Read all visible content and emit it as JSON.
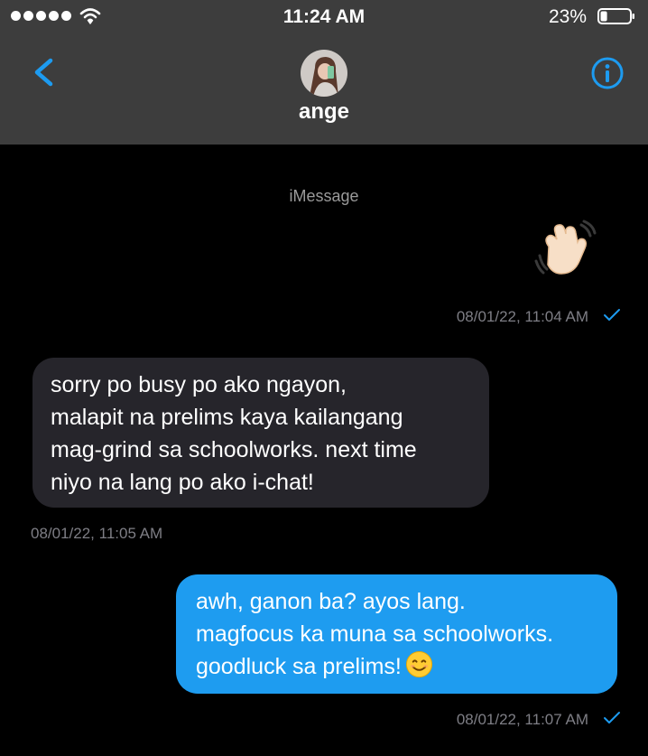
{
  "status_bar": {
    "time": "11:24 AM",
    "battery": "23%",
    "battery_level": 0.23,
    "signal_bars": 5,
    "icons": [
      "signal-dots-icon",
      "wifi-icon",
      "battery-icon"
    ]
  },
  "header": {
    "contact_name": "ange",
    "icons": [
      "back-chevron-icon",
      "avatar",
      "info-icon"
    ]
  },
  "conversation": {
    "service_label": "iMessage",
    "messages": [
      {
        "sender": "me",
        "type": "emoji",
        "emoji": "👋🏻",
        "time": "08/01/22, 11:04 AM",
        "status_icon": "checkmark-icon"
      },
      {
        "sender": "ange",
        "lines": [
          "sorry po busy po ako ngayon,",
          "malapit na prelims kaya kailangang",
          "mag-grind sa schoolworks. next time",
          "niyo na lang po ako i-chat!"
        ],
        "time": "08/01/22, 11:05 AM"
      },
      {
        "sender": "me",
        "lines": [
          "awh, ganon ba? ayos lang.",
          "magfocus ka muna sa schoolworks.",
          "goodluck sa prelims!"
        ],
        "trailing_emoji": "😊",
        "time": "08/01/22, 11:07 AM",
        "status_icon": "checkmark-icon"
      }
    ]
  },
  "colors": {
    "header_bg": "#3d3d3d",
    "background": "#000000",
    "incoming_bubble": "#26252b",
    "outgoing_bubble": "#1e9cf0",
    "accent": "#1d9bf0",
    "timestamp": "#7e7e85"
  }
}
